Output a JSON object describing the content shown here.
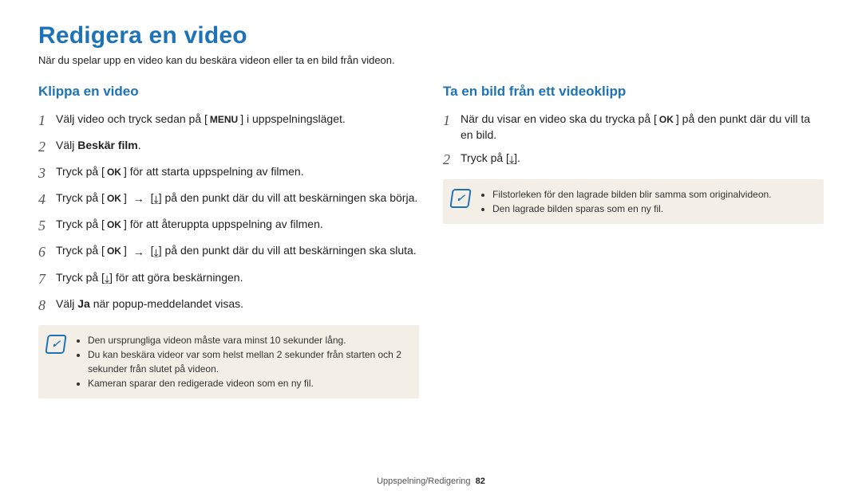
{
  "title": "Redigera en video",
  "intro": "När du spelar upp en video kan du beskära videon eller ta en bild från videon.",
  "left": {
    "heading": "Klippa en video",
    "steps": [
      {
        "prefix": "Välj video och tryck sedan på [",
        "icon": "menu",
        "suffix": "] i uppspelningsläget."
      },
      {
        "prefix": "Välj ",
        "bold": "Beskär film",
        "suffix": "."
      },
      {
        "prefix": "Tryck på [",
        "icon": "ok",
        "suffix": "] för att starta uppspelning av filmen."
      },
      {
        "prefix": "Tryck på [",
        "icon": "ok",
        "mid": "] ",
        "arrow": "→",
        "mid2": " [",
        "icon2": "down",
        "suffix": "] på den punkt där du vill att beskärningen ska börja."
      },
      {
        "prefix": "Tryck på [",
        "icon": "ok",
        "suffix": "] för att återuppta uppspelning av filmen."
      },
      {
        "prefix": "Tryck på [",
        "icon": "ok",
        "mid": "] ",
        "arrow": "→",
        "mid2": " [",
        "icon2": "down",
        "suffix": "] på den punkt där du vill att beskärningen ska sluta."
      },
      {
        "prefix": "Tryck på [",
        "icon": "down",
        "suffix": "] för att göra beskärningen."
      },
      {
        "prefix": "Välj ",
        "bold": "Ja",
        "suffix": " när popup-meddelandet visas."
      }
    ],
    "notes": [
      "Den ursprungliga videon måste vara minst 10 sekunder lång.",
      "Du kan beskära videor var som helst mellan 2 sekunder från starten och 2 sekunder från slutet på videon.",
      "Kameran sparar den redigerade videon som en ny fil."
    ]
  },
  "right": {
    "heading": "Ta en bild från ett videoklipp",
    "steps": [
      {
        "prefix": "När du visar en video ska du trycka på [",
        "icon": "ok",
        "suffix": "] på den punkt där du vill ta en bild."
      },
      {
        "prefix": "Tryck på [",
        "icon": "down",
        "suffix": "]."
      }
    ],
    "notes": [
      "Filstorleken för den lagrade bilden blir samma som originalvideon.",
      "Den lagrade bilden sparas som en ny fil."
    ]
  },
  "footer": {
    "section": "Uppspelning/Redigering",
    "page": "82"
  },
  "icons": {
    "menu": "MENU",
    "ok": "OK",
    "down": "⤓",
    "arrow": "→"
  }
}
